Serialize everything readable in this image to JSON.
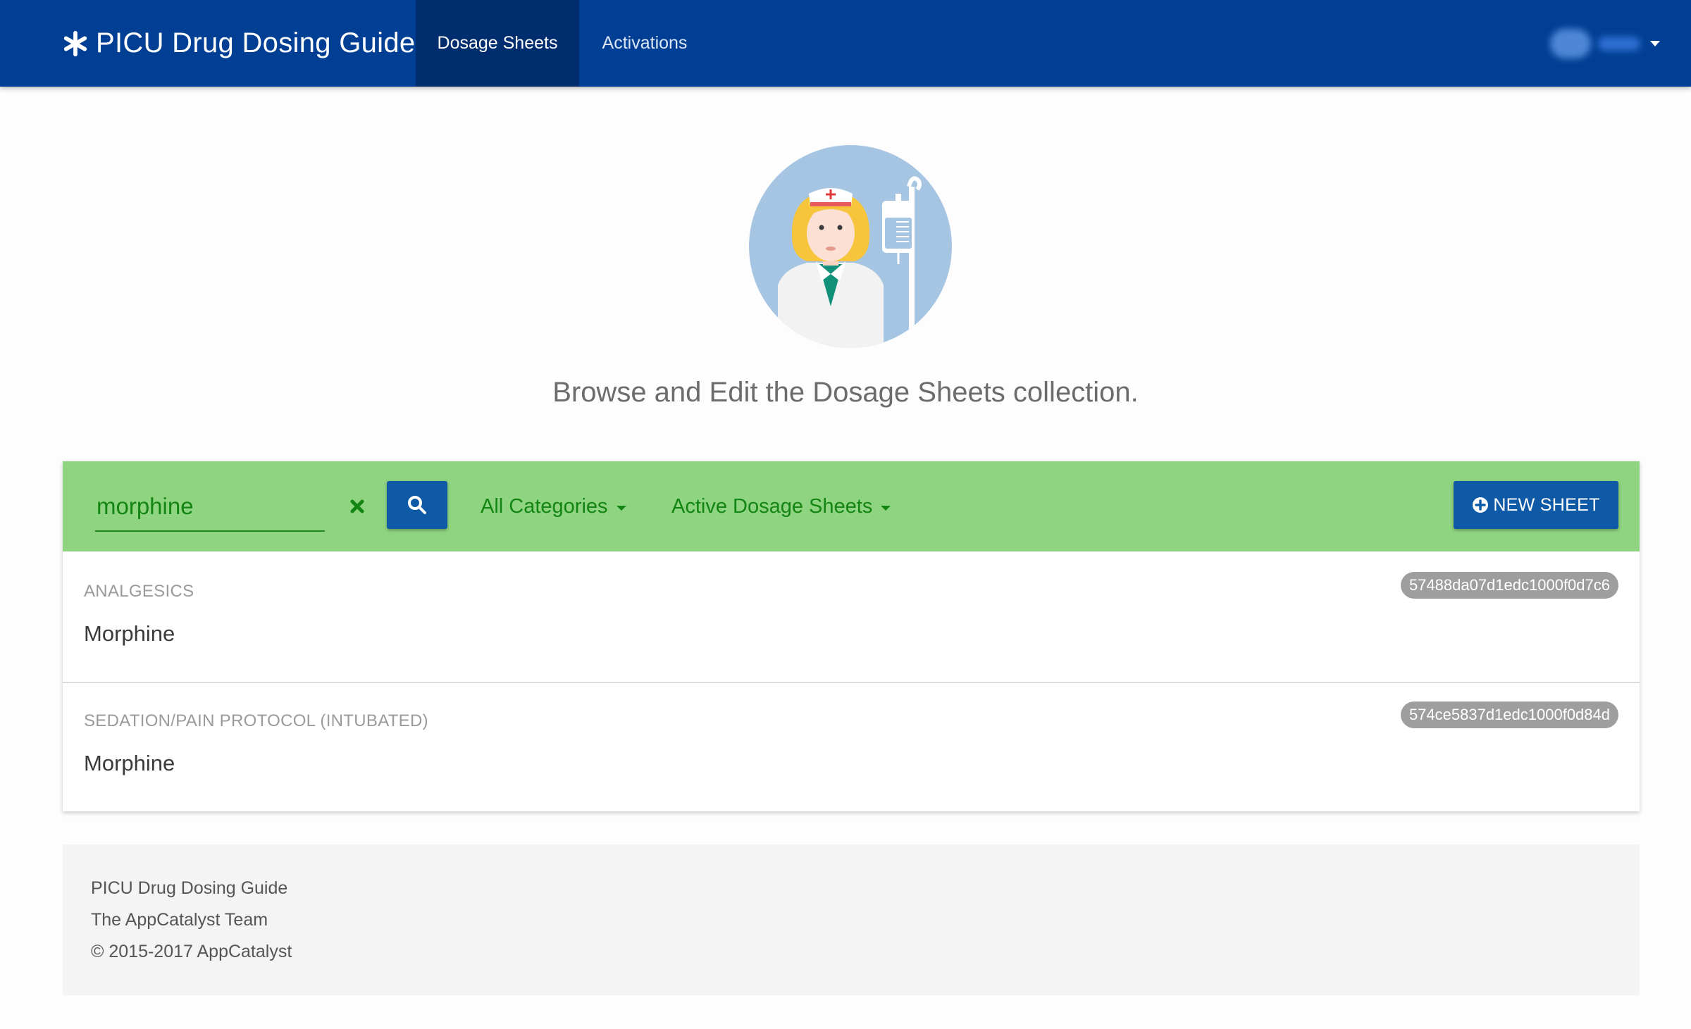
{
  "navbar": {
    "brand": "PICU Drug Dosing Guide",
    "brand_icon": "asterisk-icon",
    "tabs": [
      {
        "label": "Dosage Sheets",
        "active": true
      },
      {
        "label": "Activations",
        "active": false
      }
    ],
    "user_menu_icon": "chevron-down-icon"
  },
  "hero": {
    "illustration": "nurse-with-iv-drip",
    "text": "Browse and Edit the Dosage Sheets collection."
  },
  "toolbar": {
    "search": {
      "value": "morphine",
      "placeholder": ""
    },
    "clear_icon": "close-icon",
    "search_icon": "search-icon",
    "category_filter": "All Categories",
    "status_filter": "Active Dosage Sheets",
    "new_sheet_label": "NEW SHEET",
    "new_sheet_icon": "plus-circle-icon"
  },
  "results": [
    {
      "category": "ANALGESICS",
      "name": "Morphine",
      "id": "57488da07d1edc1000f0d7c6"
    },
    {
      "category": "SEDATION/PAIN PROTOCOL (INTUBATED)",
      "name": "Morphine",
      "id": "574ce5837d1edc1000f0d84d"
    }
  ],
  "footer": {
    "line1": "PICU Drug Dosing Guide",
    "line2": "The AppCatalyst Team",
    "line3": "© 2015-2017 AppCatalyst"
  },
  "colors": {
    "navbar": "#003f93",
    "navbar_active": "#002d6d",
    "toolbar": "#8fd480",
    "toolbar_text": "#128512",
    "primary_button": "#0f5aa6",
    "badge": "#9e9e9e"
  }
}
